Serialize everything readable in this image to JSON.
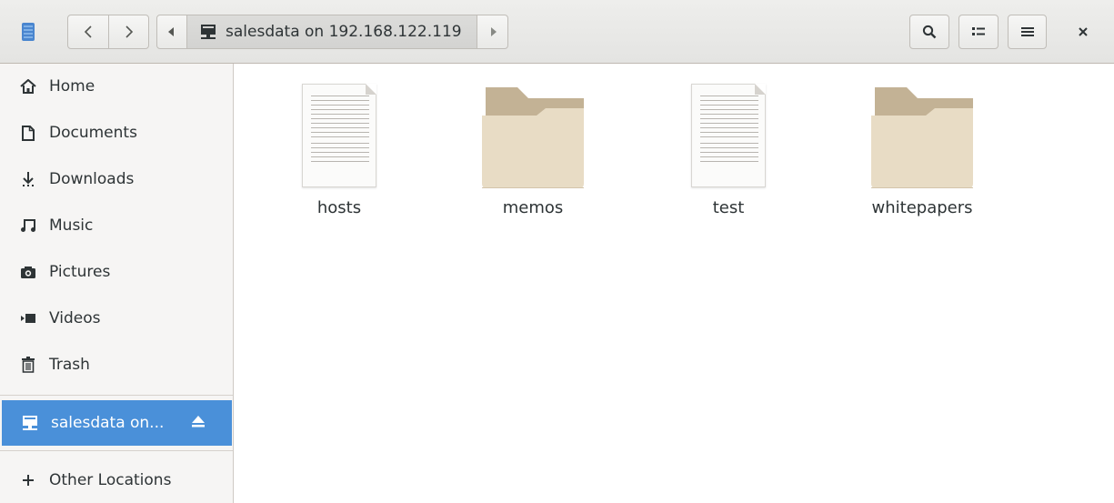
{
  "toolbar": {
    "location_label": "salesdata on 192.168.122.119"
  },
  "sidebar": {
    "items": [
      {
        "label": "Home",
        "icon": "home-icon"
      },
      {
        "label": "Documents",
        "icon": "document-icon"
      },
      {
        "label": "Downloads",
        "icon": "download-icon"
      },
      {
        "label": "Music",
        "icon": "music-icon"
      },
      {
        "label": "Pictures",
        "icon": "camera-icon"
      },
      {
        "label": "Videos",
        "icon": "video-icon"
      },
      {
        "label": "Trash",
        "icon": "trash-icon"
      }
    ],
    "mounted": {
      "label": "salesdata on...",
      "icon": "network-share-icon"
    },
    "other": {
      "label": "Other Locations",
      "icon": "plus-icon"
    }
  },
  "files": [
    {
      "name": "hosts",
      "type": "file"
    },
    {
      "name": "memos",
      "type": "folder"
    },
    {
      "name": "test",
      "type": "file"
    },
    {
      "name": "whitepapers",
      "type": "folder"
    }
  ],
  "colors": {
    "accent": "#4a90d9",
    "folder_front": "#e8dcc5",
    "folder_back": "#c3b295"
  }
}
